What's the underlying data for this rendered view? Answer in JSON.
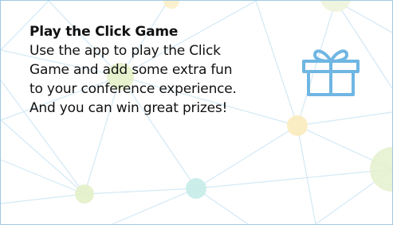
{
  "promo": {
    "title": "Play the Click Game",
    "lines": [
      "Use the app to play the Click",
      "Game and add some extra fun",
      "to your conference experience.",
      "And you can win great prizes!"
    ],
    "icon": "gift-icon"
  },
  "colors": {
    "border": "#9fc9e3",
    "network_lines": "#cfe7f3",
    "icon": "#6fb6e3",
    "text": "#111111"
  }
}
